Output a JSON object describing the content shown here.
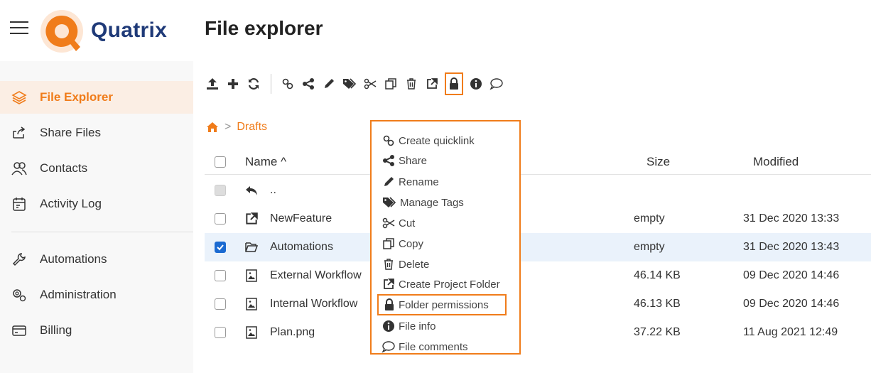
{
  "header": {
    "app_name": "Quatrix",
    "page_title": "File explorer",
    "brand_color": "#f07c1a",
    "logo_color": "#1f3a78"
  },
  "sidebar": {
    "items": [
      {
        "label": "File Explorer",
        "icon": "layers-icon",
        "active": true
      },
      {
        "label": "Share Files",
        "icon": "share-icon"
      },
      {
        "label": "Contacts",
        "icon": "contacts-icon"
      },
      {
        "label": "Activity Log",
        "icon": "activity-log-icon"
      },
      {
        "label": "Automations",
        "icon": "wrench-icon"
      },
      {
        "label": "Administration",
        "icon": "gears-icon"
      },
      {
        "label": "Billing",
        "icon": "credit-card-icon"
      }
    ]
  },
  "toolbar": {
    "buttons": [
      "upload-icon",
      "plus-icon",
      "refresh-icon",
      "link-icon",
      "share-icon",
      "pencil-icon",
      "tags-icon",
      "scissors-icon",
      "copy-icon",
      "trash-icon",
      "external-share-icon",
      "lock-icon",
      "info-icon",
      "comment-icon"
    ]
  },
  "breadcrumb": {
    "home_icon": "home-icon",
    "separator": ">",
    "current": "Drafts"
  },
  "table": {
    "columns": {
      "name": "Name ^",
      "size": "Size",
      "modified": "Modified"
    },
    "parent_label": "..",
    "rows": [
      {
        "name": "NewFeature",
        "icon": "external-share-icon",
        "size": "empty",
        "modified": "31 Dec 2020 13:33",
        "checked": false
      },
      {
        "name": "Automations",
        "icon": "folder-open-icon",
        "size": "empty",
        "modified": "31 Dec 2020 13:43",
        "checked": true
      },
      {
        "name": "External Workflow",
        "icon": "image-file-icon",
        "size": "46.14 KB",
        "modified": "09 Dec 2020 14:46",
        "checked": false
      },
      {
        "name": "Internal Workflow",
        "icon": "image-file-icon",
        "size": "46.13 KB",
        "modified": "09 Dec 2020 14:46",
        "checked": false
      },
      {
        "name": "Plan.png",
        "icon": "image-file-icon",
        "size": "37.22 KB",
        "modified": "11 Aug 2021 12:49",
        "checked": false
      }
    ]
  },
  "context_menu": {
    "items": [
      {
        "label": "Create quicklink",
        "icon": "link-icon"
      },
      {
        "label": "Share",
        "icon": "share-icon"
      },
      {
        "label": "Rename",
        "icon": "pencil-icon"
      },
      {
        "label": "Manage Tags",
        "icon": "tags-icon"
      },
      {
        "label": "Cut",
        "icon": "scissors-icon"
      },
      {
        "label": "Copy",
        "icon": "copy-icon"
      },
      {
        "label": "Delete",
        "icon": "trash-icon"
      },
      {
        "label": "Create Project Folder",
        "icon": "external-share-icon"
      },
      {
        "label": "Folder permissions",
        "icon": "lock-icon",
        "highlighted": true
      },
      {
        "label": "File info",
        "icon": "info-icon"
      },
      {
        "label": "File comments",
        "icon": "comment-icon"
      }
    ]
  }
}
